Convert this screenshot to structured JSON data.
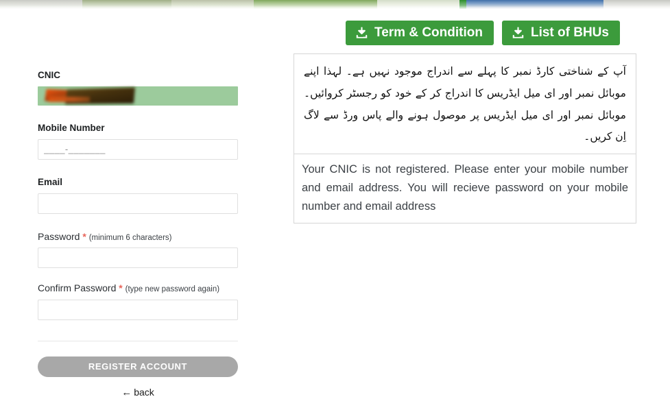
{
  "banner": {
    "alt": "site-header-banner-strip"
  },
  "form": {
    "cnic": {
      "label": "CNIC",
      "value": "",
      "redacted": true,
      "field_bg": "#9ccb9c"
    },
    "mobile": {
      "label": "Mobile Number",
      "value": "",
      "placeholder": "____-_______"
    },
    "email": {
      "label": "Email",
      "value": "",
      "placeholder": ""
    },
    "password": {
      "label": "Password",
      "required_mark": "*",
      "hint": "(minimum 6 characters)",
      "value": "",
      "placeholder": ""
    },
    "confirm_password": {
      "label": "Confirm Password",
      "required_mark": "*",
      "hint": "(type new password again)",
      "value": "",
      "placeholder": ""
    },
    "submit_label": "REGISTER ACCOUNT",
    "submit_color": "#a8a8a8",
    "back_label": "back",
    "back_arrow": "←"
  },
  "actions": {
    "terms_label": "Term & Condition",
    "bhu_label": "List of BHUs",
    "button_color": "#3c9b3c",
    "icon_name": "download-icon"
  },
  "message": {
    "urdu": "آپ کے شناختی کارڈ نمبر کا پہلے سے اندراج موجود نہیں ہے۔ لہذا اپنے موبائل نمبر اور ای میل ایڈریس کا اندراج کر کے خود کو رجسٹر کروائیں۔ موبائل نمبر اور ای میل ایڈریس پر موصول ہونے والے پاس ورڈ سے لاگ اِن کریں۔",
    "english": "Your CNIC is not registered. Please enter your mobile number and email address. You will recieve password on your mobile number and email address"
  }
}
